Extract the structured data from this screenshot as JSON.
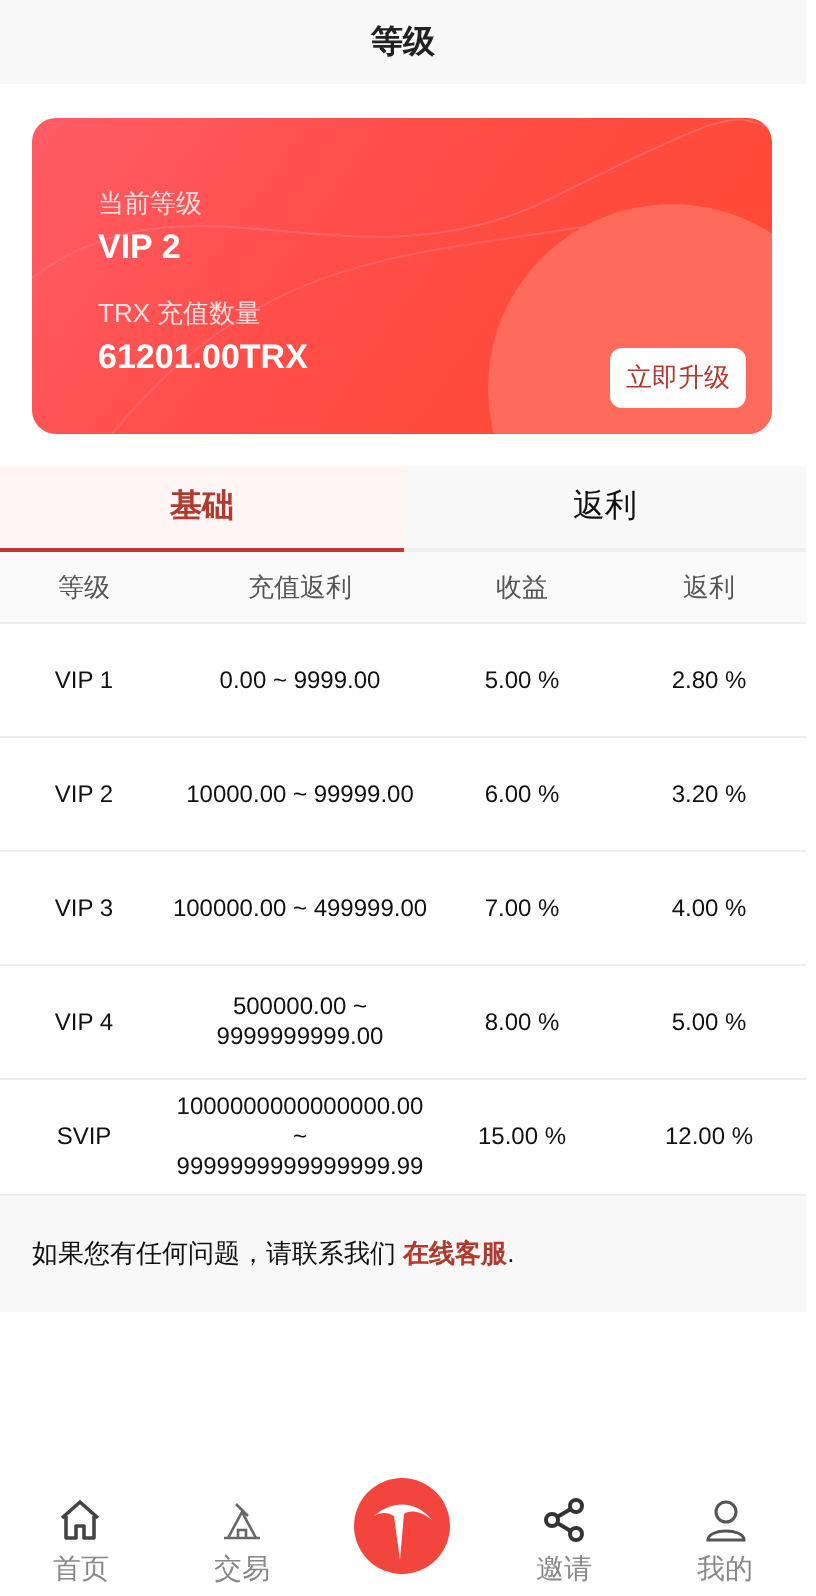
{
  "header": {
    "title": "等级"
  },
  "card": {
    "level_label": "当前等级",
    "level": "VIP 2",
    "amount_label": "TRX 充值数量",
    "amount": "61201.00TRX",
    "upgrade_button": "立即升级"
  },
  "tabs": [
    {
      "label": "基础",
      "selected": true
    },
    {
      "label": "返利",
      "selected": false
    }
  ],
  "table": {
    "columns": [
      "等级",
      "充值返利",
      "收益",
      "返利"
    ],
    "rows": [
      [
        "VIP 1",
        "0.00 ~ 9999.00",
        "5.00 %",
        "2.80 %"
      ],
      [
        "VIP 2",
        "10000.00 ~ 99999.00",
        "6.00 %",
        "3.20 %"
      ],
      [
        "VIP 3",
        "100000.00 ~ 499999.00",
        "7.00 %",
        "4.00 %"
      ],
      [
        "VIP 4",
        "500000.00 ~ 9999999999.00",
        "8.00 %",
        "5.00 %"
      ],
      [
        "SVIP",
        "1000000000000000.00 ~ 9999999999999999.99",
        "15.00 %",
        "12.00 %"
      ]
    ]
  },
  "help": {
    "text": "如果您有任何问题，请联系我们",
    "link": "在线客服",
    "end": "."
  },
  "nav": [
    {
      "kind": "home",
      "label": "首页"
    },
    {
      "kind": "trade",
      "label": "交易"
    },
    {
      "kind": "logo"
    },
    {
      "kind": "share",
      "label": "邀请"
    },
    {
      "kind": "user",
      "label": "我的"
    }
  ]
}
